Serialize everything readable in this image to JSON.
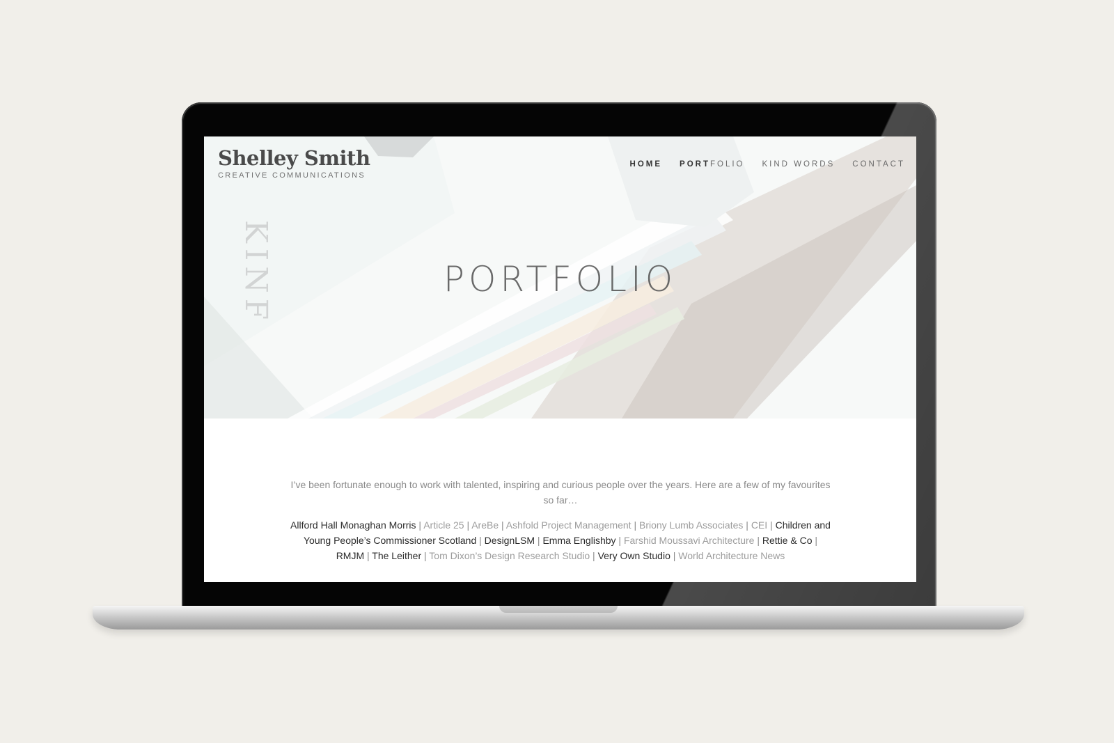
{
  "site": {
    "brand_name": "Shelley Smith",
    "brand_tagline": "CREATIVE COMMUNICATIONS"
  },
  "nav": {
    "items": [
      {
        "label": "HOME",
        "active": true
      },
      {
        "label_bold": "PORT",
        "label_rest": "FOLIO"
      },
      {
        "label": "KIND WORDS"
      },
      {
        "label": "CONTACT"
      }
    ]
  },
  "hero": {
    "title": "PORTFOLIO",
    "image_text": "KINF"
  },
  "content": {
    "intro": "I’ve been fortunate enough to work with talented, inspiring and curious people over the years. Here are a few of my favourites so far…",
    "clients": [
      {
        "name": "Allford Hall Monaghan Morris",
        "style": "dark"
      },
      {
        "name": "Article 25",
        "style": "light"
      },
      {
        "name": "AreBe",
        "style": "light"
      },
      {
        "name": "Ashfold Project Management",
        "style": "light"
      },
      {
        "name": "Briony Lumb Associates",
        "style": "light"
      },
      {
        "name": "CEI",
        "style": "light"
      },
      {
        "name": "Children and Young People’s Commissioner Scotland",
        "style": "dark"
      },
      {
        "name": "DesignLSM",
        "style": "dark"
      },
      {
        "name": "Emma Englishby",
        "style": "dark"
      },
      {
        "name": "Farshid Moussavi Architecture",
        "style": "light"
      },
      {
        "name": "Rettie & Co",
        "style": "dark"
      },
      {
        "name": "RMJM",
        "style": "dark"
      },
      {
        "name": "The Leither",
        "style": "dark"
      },
      {
        "name": "Tom Dixon’s Design Research Studio",
        "style": "light"
      },
      {
        "name": "Very Own Studio",
        "style": "dark"
      },
      {
        "name": "World Architecture News",
        "style": "light"
      }
    ],
    "separator": "|"
  },
  "colors": {
    "page_background": "#f1efea",
    "bezel": "#050505",
    "text_dark": "#2b2b2b",
    "text_light": "#9c9c9c"
  }
}
